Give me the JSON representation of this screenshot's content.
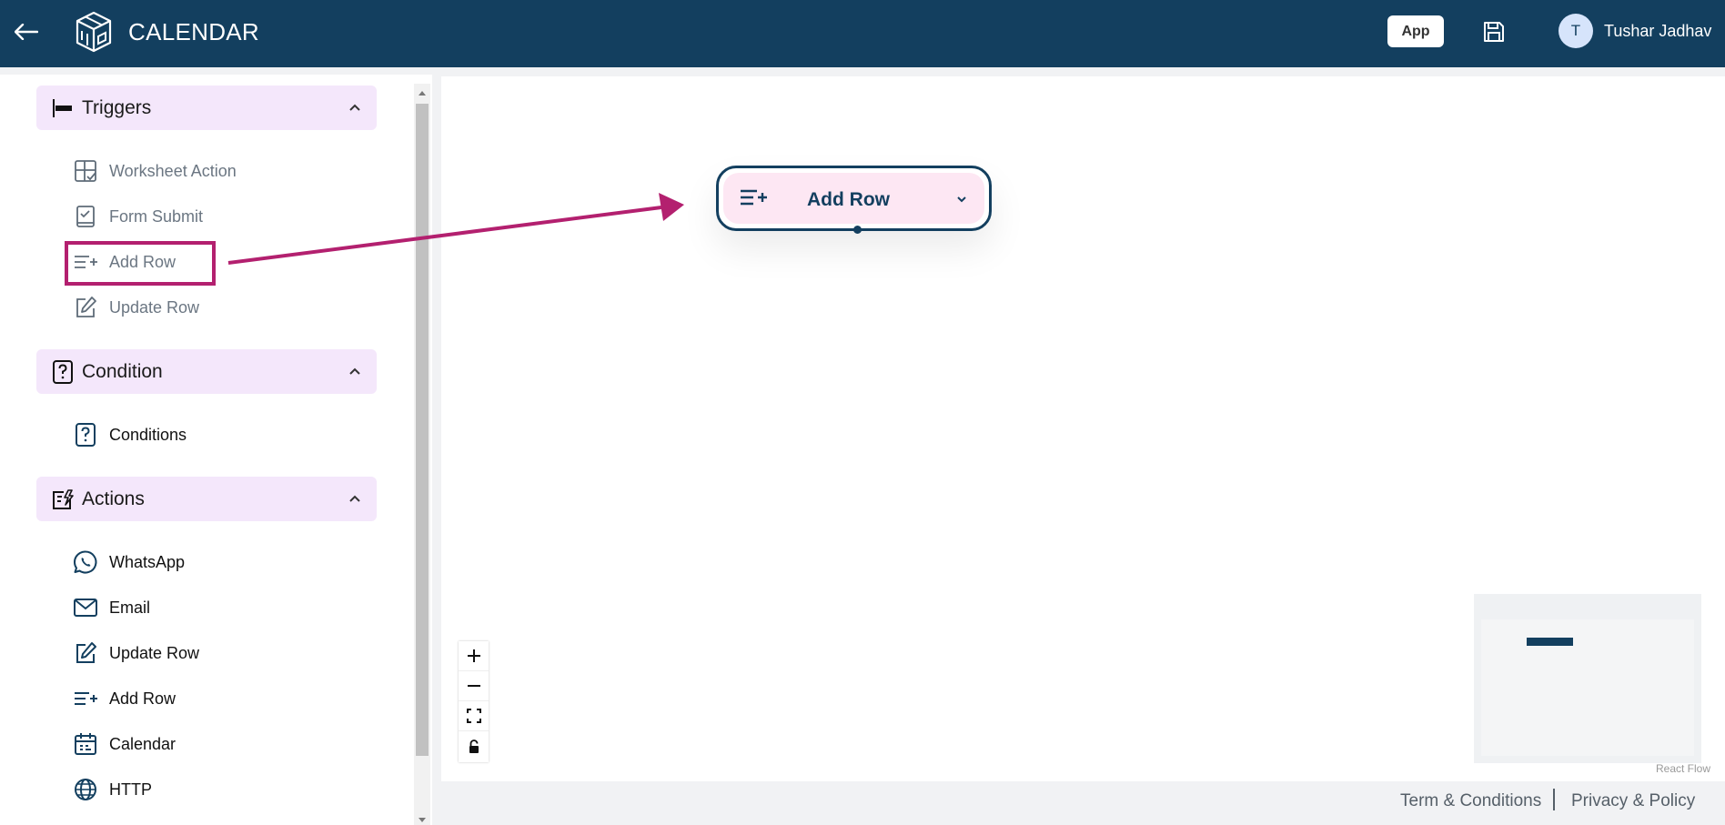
{
  "header": {
    "title": "CALENDAR",
    "app_button": "App",
    "user": {
      "initial": "T",
      "name": "Tushar Jadhav"
    }
  },
  "sidebar": {
    "sections": [
      {
        "label": "Triggers",
        "icon": "trigger-icon",
        "items": [
          {
            "label": "Worksheet Action",
            "icon": "worksheet-action-icon"
          },
          {
            "label": "Form Submit",
            "icon": "form-submit-icon"
          },
          {
            "label": "Add Row",
            "icon": "add-row-icon",
            "highlighted": true
          },
          {
            "label": "Update Row",
            "icon": "edit-icon"
          }
        ]
      },
      {
        "label": "Condition",
        "icon": "condition-icon",
        "items": [
          {
            "label": "Conditions",
            "icon": "condition-icon"
          }
        ]
      },
      {
        "label": "Actions",
        "icon": "actions-icon",
        "items": [
          {
            "label": "WhatsApp",
            "icon": "whatsapp-icon"
          },
          {
            "label": "Email",
            "icon": "email-icon"
          },
          {
            "label": "Update Row",
            "icon": "edit-icon"
          },
          {
            "label": "Add Row",
            "icon": "add-row-icon"
          },
          {
            "label": "Calendar",
            "icon": "calendar-icon"
          },
          {
            "label": "HTTP",
            "icon": "globe-icon"
          }
        ]
      }
    ]
  },
  "canvas": {
    "node": {
      "label": "Add Row",
      "icon": "add-row-icon"
    },
    "controls": [
      "zoom-in-icon",
      "zoom-out-icon",
      "fit-view-icon",
      "lock-icon"
    ],
    "attribution": "React Flow"
  },
  "footer": {
    "terms": "Term & Conditions",
    "privacy": "Privacy & Policy"
  },
  "colors": {
    "header_bg": "#133f5f",
    "section_bg": "#f4e7fb",
    "node_bg": "#fde7f3",
    "highlight": "#b3206f"
  }
}
